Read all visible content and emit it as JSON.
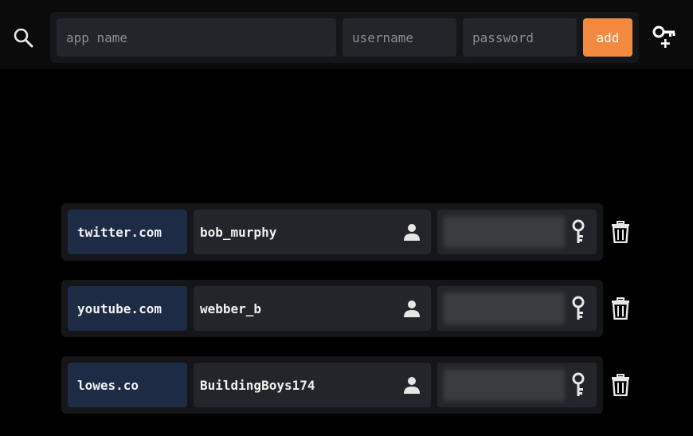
{
  "header": {
    "search_icon": "search-icon",
    "app_name_placeholder": "app name",
    "username_placeholder": "username",
    "password_placeholder": "password",
    "add_label": "add",
    "add_color": "#f28b40",
    "add_key_icon": "key-plus-icon"
  },
  "entries": [
    {
      "app": "twitter.com",
      "username": "bob_murphy",
      "password": "hidden"
    },
    {
      "app": "youtube.com",
      "username": "webber_b",
      "password": "hidden"
    },
    {
      "app": "lowes.co",
      "username": "BuildingBoys174",
      "password": "hidden"
    }
  ],
  "icons": {
    "user": "user-icon",
    "key": "key-icon",
    "delete": "trash-icon"
  },
  "colors": {
    "background": "#000000",
    "panel": "#151619",
    "field": "#23252a",
    "app_cell": "#1e2b45",
    "accent": "#f28b40"
  }
}
